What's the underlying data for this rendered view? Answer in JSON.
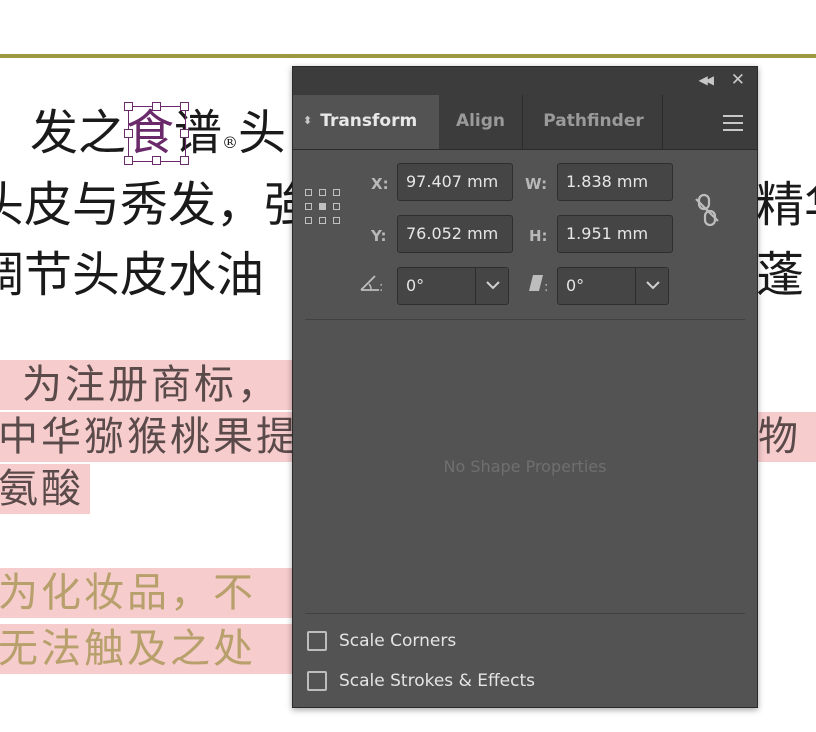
{
  "document": {
    "line1_before": "发之",
    "line1_selected": "食",
    "line1_after": "谱",
    "line1_mark": "®",
    "line1_tail": "头",
    "line2": "头皮与秀发，強",
    "line2_right": "精华",
    "line3": "调节头皮水油",
    "line3_right": "蓬",
    "pink1": "为注册商标，",
    "pink2": "中华猕猴桃果提",
    "pink2_right": "物",
    "pink3": "氨酸",
    "gold1": "为化妆品，不",
    "gold2": "无法触及之处"
  },
  "panel": {
    "tabs": [
      {
        "label": "Transform",
        "active": true
      },
      {
        "label": "Align",
        "active": false
      },
      {
        "label": "Pathfinder",
        "active": false
      }
    ],
    "fields": {
      "x_label": "X:",
      "x_value": "97.407 mm",
      "y_label": "Y:",
      "y_value": "76.052 mm",
      "w_label": "W:",
      "w_value": "1.838 mm",
      "h_label": "H:",
      "h_value": "1.951 mm",
      "rotate_value": "0°",
      "shear_value": "0°"
    },
    "empty_message": "No Shape Properties",
    "checkboxes": [
      {
        "label": "Scale Corners",
        "checked": false
      },
      {
        "label": "Scale Strokes & Effects",
        "checked": false
      }
    ]
  }
}
